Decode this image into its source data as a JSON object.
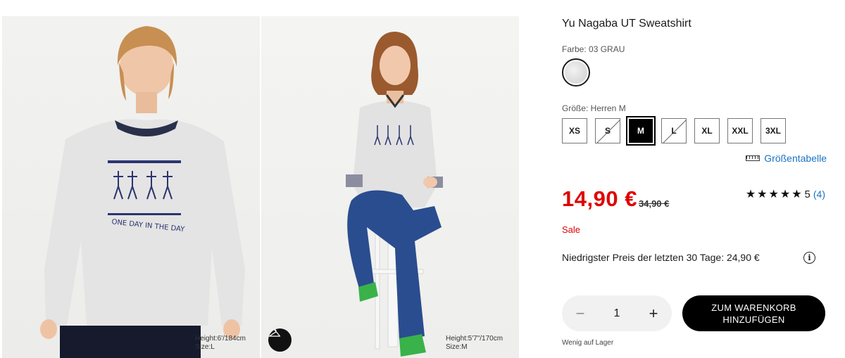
{
  "gallery": {
    "photo1": {
      "caption_height": "Height:6'/184cm",
      "caption_size": "Size:L"
    },
    "photo2": {
      "caption_height": "Height:5'7\"/170cm",
      "caption_size": "Size:M"
    },
    "print_text": "ONE DAY IN THE DAY",
    "hanger_icon": "hanger-icon"
  },
  "product": {
    "title": "Yu Nagaba UT Sweatshirt",
    "color_label": "Farbe: 03 GRAU",
    "size_label": "Größe: Herren M",
    "sizes": [
      {
        "label": "XS",
        "state": "available"
      },
      {
        "label": "S",
        "state": "unavailable"
      },
      {
        "label": "M",
        "state": "selected"
      },
      {
        "label": "L",
        "state": "unavailable"
      },
      {
        "label": "XL",
        "state": "available"
      },
      {
        "label": "XXL",
        "state": "available"
      },
      {
        "label": "3XL",
        "state": "available"
      }
    ],
    "size_chart_label": "Größentabelle",
    "price": "14,90 €",
    "old_price": "34,90 €",
    "rating_stars": "★★★★★",
    "rating_value": "5",
    "rating_count": "(4)",
    "sale_label": "Sale",
    "lowest_price_text": "Niedrigster Preis der letzten 30 Tage: 24,90 €",
    "info_icon_glyph": "i",
    "quantity": "1",
    "qty_minus": "−",
    "qty_plus": "+",
    "cart_button_line1": "ZUM WARENKORB",
    "cart_button_line2": "HINZUFÜGEN",
    "stock_text": "Wenig auf Lager"
  },
  "colors": {
    "price_red": "#e00000",
    "link_blue": "#1a73c4",
    "button_black": "#000000"
  }
}
